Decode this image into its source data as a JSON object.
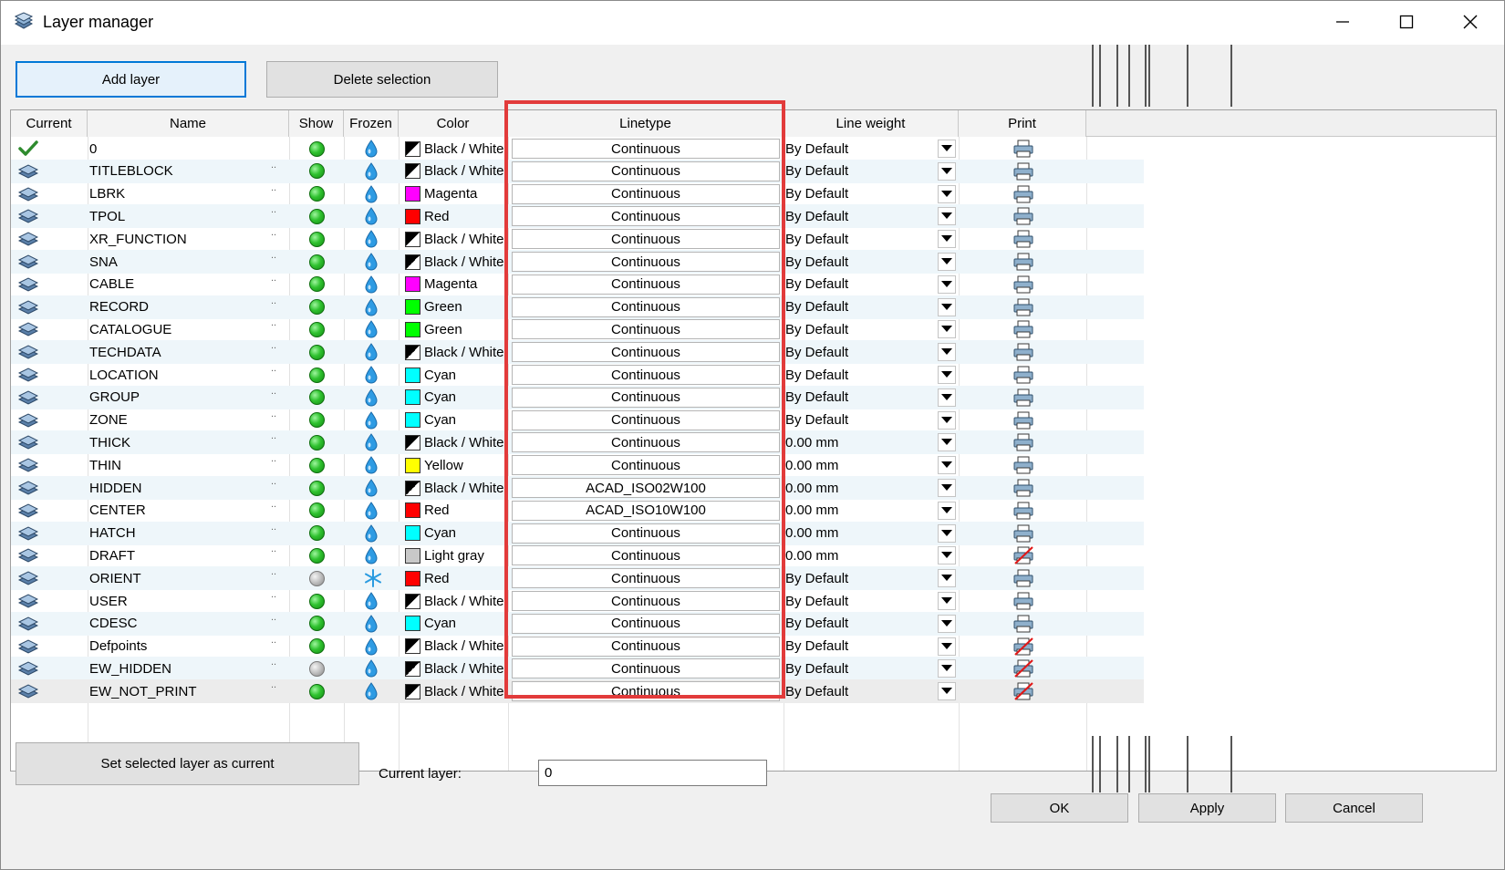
{
  "window": {
    "title": "Layer manager"
  },
  "toolbar": {
    "add_layer": "Add layer",
    "delete_selection": "Delete selection"
  },
  "columns": [
    "Current",
    "Name",
    "Show",
    "Frozen",
    "Color",
    "Linetype",
    "Line weight",
    "Print"
  ],
  "name_suffix": "..",
  "colors": {
    "Black / White": "bw",
    "Magenta": "#ff00ff",
    "Red": "#ff0000",
    "Green": "#00ff00",
    "Cyan": "#00ffff",
    "Yellow": "#ffff00",
    "Light gray": "#c8c8c8"
  },
  "layers": [
    {
      "name": "0",
      "current": true,
      "show": true,
      "frozen": false,
      "color": "Black / White",
      "linetype": "Continuous",
      "weight": "By Default",
      "print": true
    },
    {
      "name": "TITLEBLOCK",
      "current": false,
      "show": true,
      "frozen": false,
      "color": "Black / White",
      "linetype": "Continuous",
      "weight": "By Default",
      "print": true
    },
    {
      "name": "LBRK",
      "current": false,
      "show": true,
      "frozen": false,
      "color": "Magenta",
      "linetype": "Continuous",
      "weight": "By Default",
      "print": true
    },
    {
      "name": "TPOL",
      "current": false,
      "show": true,
      "frozen": false,
      "color": "Red",
      "linetype": "Continuous",
      "weight": "By Default",
      "print": true
    },
    {
      "name": "XR_FUNCTION",
      "current": false,
      "show": true,
      "frozen": false,
      "color": "Black / White",
      "linetype": "Continuous",
      "weight": "By Default",
      "print": true
    },
    {
      "name": "SNA",
      "current": false,
      "show": true,
      "frozen": false,
      "color": "Black / White",
      "linetype": "Continuous",
      "weight": "By Default",
      "print": true
    },
    {
      "name": "CABLE",
      "current": false,
      "show": true,
      "frozen": false,
      "color": "Magenta",
      "linetype": "Continuous",
      "weight": "By Default",
      "print": true
    },
    {
      "name": "RECORD",
      "current": false,
      "show": true,
      "frozen": false,
      "color": "Green",
      "linetype": "Continuous",
      "weight": "By Default",
      "print": true
    },
    {
      "name": "CATALOGUE",
      "current": false,
      "show": true,
      "frozen": false,
      "color": "Green",
      "linetype": "Continuous",
      "weight": "By Default",
      "print": true
    },
    {
      "name": "TECHDATA",
      "current": false,
      "show": true,
      "frozen": false,
      "color": "Black / White",
      "linetype": "Continuous",
      "weight": "By Default",
      "print": true
    },
    {
      "name": "LOCATION",
      "current": false,
      "show": true,
      "frozen": false,
      "color": "Cyan",
      "linetype": "Continuous",
      "weight": "By Default",
      "print": true
    },
    {
      "name": "GROUP",
      "current": false,
      "show": true,
      "frozen": false,
      "color": "Cyan",
      "linetype": "Continuous",
      "weight": "By Default",
      "print": true
    },
    {
      "name": "ZONE",
      "current": false,
      "show": true,
      "frozen": false,
      "color": "Cyan",
      "linetype": "Continuous",
      "weight": "By Default",
      "print": true
    },
    {
      "name": "THICK",
      "current": false,
      "show": true,
      "frozen": false,
      "color": "Black / White",
      "linetype": "Continuous",
      "weight": "0.00 mm",
      "print": true
    },
    {
      "name": "THIN",
      "current": false,
      "show": true,
      "frozen": false,
      "color": "Yellow",
      "linetype": "Continuous",
      "weight": "0.00 mm",
      "print": true
    },
    {
      "name": "HIDDEN",
      "current": false,
      "show": true,
      "frozen": false,
      "color": "Black / White",
      "linetype": "ACAD_ISO02W100",
      "weight": "0.00 mm",
      "print": true
    },
    {
      "name": "CENTER",
      "current": false,
      "show": true,
      "frozen": false,
      "color": "Red",
      "linetype": "ACAD_ISO10W100",
      "weight": "0.00 mm",
      "print": true
    },
    {
      "name": "HATCH",
      "current": false,
      "show": true,
      "frozen": false,
      "color": "Cyan",
      "linetype": "Continuous",
      "weight": "0.00 mm",
      "print": true
    },
    {
      "name": "DRAFT",
      "current": false,
      "show": true,
      "frozen": false,
      "color": "Light gray",
      "linetype": "Continuous",
      "weight": "0.00 mm",
      "print": false
    },
    {
      "name": "ORIENT",
      "current": false,
      "show": false,
      "frozen": true,
      "color": "Red",
      "linetype": "Continuous",
      "weight": "By Default",
      "print": true
    },
    {
      "name": "USER",
      "current": false,
      "show": true,
      "frozen": false,
      "color": "Black / White",
      "linetype": "Continuous",
      "weight": "By Default",
      "print": true
    },
    {
      "name": "CDESC",
      "current": false,
      "show": true,
      "frozen": false,
      "color": "Cyan",
      "linetype": "Continuous",
      "weight": "By Default",
      "print": true
    },
    {
      "name": "Defpoints",
      "current": false,
      "show": true,
      "frozen": false,
      "color": "Black / White",
      "linetype": "Continuous",
      "weight": "By Default",
      "print": false
    },
    {
      "name": "EW_HIDDEN",
      "current": false,
      "show": false,
      "frozen": false,
      "color": "Black / White",
      "linetype": "Continuous",
      "weight": "By Default",
      "print": false
    },
    {
      "name": "EW_NOT_PRINT",
      "current": false,
      "show": true,
      "frozen": false,
      "color": "Black / White",
      "linetype": "Continuous",
      "weight": "By Default",
      "print": false
    }
  ],
  "footer": {
    "set_current": "Set selected layer as current",
    "current_layer_label": "Current layer:",
    "current_layer_value": "0",
    "ok": "OK",
    "apply": "Apply",
    "cancel": "Cancel"
  }
}
